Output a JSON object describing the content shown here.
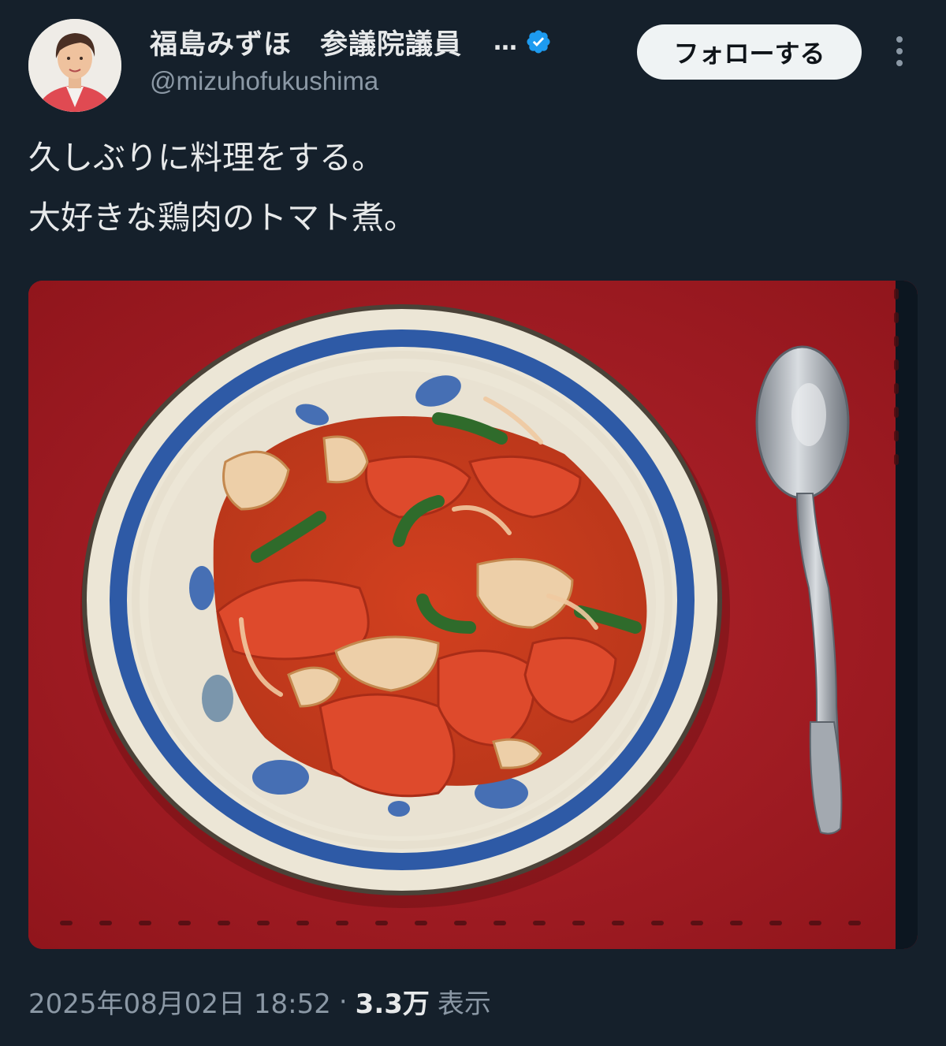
{
  "author": {
    "display_name": "福島みずほ　参議院議員",
    "truncation": "…",
    "handle": "@mizuhofukushima",
    "verified": true,
    "verified_color": "#1d9bf0"
  },
  "actions": {
    "follow_label": "フォローする"
  },
  "tweet": {
    "lines": [
      "久しぶりに料理をする。",
      "大好きな鶏肉のトマト煮。"
    ]
  },
  "meta": {
    "timestamp": "2025年08月02日 18:52",
    "separator": "·",
    "views_count": "3.3万",
    "views_label": "表示"
  },
  "icons": {
    "verified": "verified-badge-icon",
    "more": "more-vertical-icon"
  },
  "colors": {
    "background": "#15202b",
    "text_primary": "#e7e9ea",
    "text_secondary": "#8b98a5",
    "follow_button_bg": "#eff3f4"
  }
}
